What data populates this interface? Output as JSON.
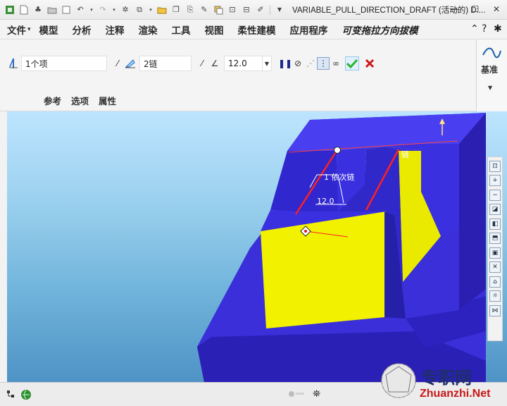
{
  "window": {
    "title": "VARIABLE_PULL_DIRECTION_DRAFT (活动的) D:..."
  },
  "menu": {
    "items": [
      "文件",
      "模型",
      "分析",
      "注释",
      "渲染",
      "工具",
      "视图",
      "柔性建模",
      "应用程序",
      "可变拖拉方向拔模"
    ],
    "file_arrow": "▾"
  },
  "dashboard": {
    "ref_value": "1个项",
    "chain_value": "2链",
    "angle_value": "12.0"
  },
  "panel_tabs": [
    "参考",
    "选项",
    "属性"
  ],
  "datum": {
    "label": "基准"
  },
  "viewport": {
    "label_chain_top": "1 依次链",
    "label_chain_right": "链",
    "label_angle": "12.0"
  },
  "watermark": {
    "cn": "专职网",
    "en": "Zhuanzhi.Net"
  },
  "colors": {
    "model_blue": "#3a2fd8",
    "face_yellow": "#f2f200",
    "edge_red": "#ff2020",
    "ok_green": "#2bb52b",
    "cancel_red": "#d01818"
  }
}
